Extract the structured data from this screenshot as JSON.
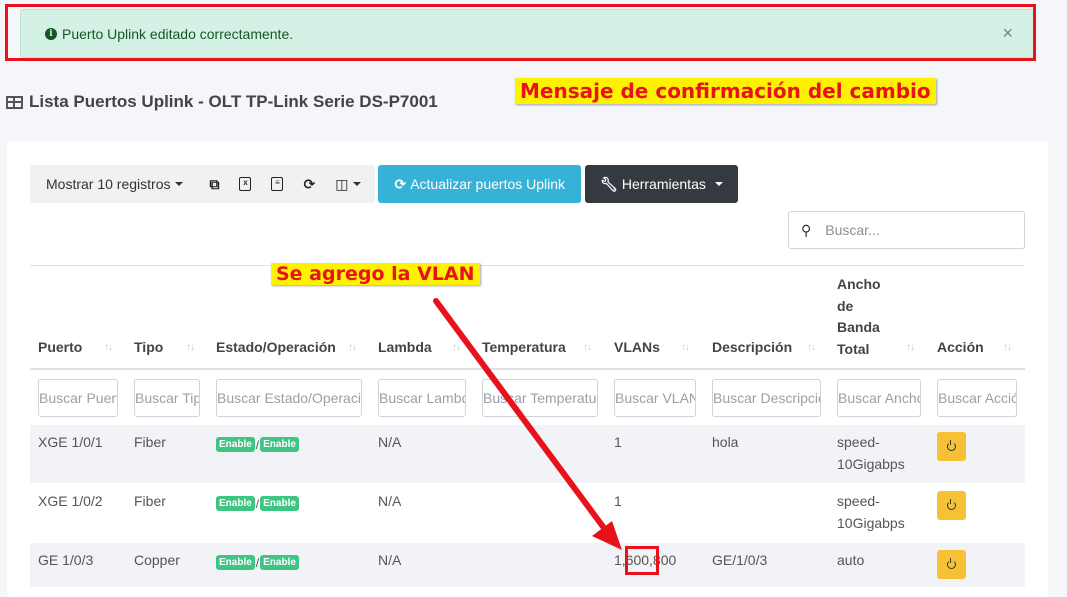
{
  "alert": {
    "text": "Puerto Uplink editado correctamente.",
    "close": "×",
    "icon": "info-circle-icon"
  },
  "title": "Lista Puertos Uplink - OLT TP-Link Serie DS-P7001",
  "annotations": {
    "confirm": "Mensaje de confirmación del cambio",
    "vlan": "Se agrego la VLAN"
  },
  "toolbar": {
    "show": "Mostrar 10 registros",
    "icons": [
      "copy-icon",
      "excel-icon",
      "csv-icon",
      "refresh-icon",
      "columns-icon"
    ],
    "update": "Actualizar puertos Uplink",
    "tools": "Herramientas"
  },
  "search": {
    "placeholder": "Buscar..."
  },
  "columns": [
    "Puerto",
    "Tipo",
    "Estado/Operación",
    "Lambda",
    "Temperatura",
    "VLANs",
    "Descripción",
    "Ancho de Banda Total",
    "Acción"
  ],
  "ancho_lines": [
    "Ancho",
    "de",
    "Banda",
    "Total"
  ],
  "filters": [
    "Buscar Puerto",
    "Buscar Tipo",
    "Buscar Estado/Operación",
    "Buscar Lambda",
    "Buscar Temperatura",
    "Buscar VLANs",
    "Buscar Descripción",
    "Buscar Ancho",
    "Buscar Acción"
  ],
  "rows": [
    {
      "puerto": "XGE 1/0/1",
      "tipo": "Fiber",
      "estado": "Enable",
      "operacion": "Enable",
      "lambda": "N/A",
      "temperatura": "",
      "vlans": "1",
      "descripcion": "hola",
      "ancho1": "speed-",
      "ancho2": "10Gigabps"
    },
    {
      "puerto": "XGE 1/0/2",
      "tipo": "Fiber",
      "estado": "Enable",
      "operacion": "Enable",
      "lambda": "N/A",
      "temperatura": "",
      "vlans": "1",
      "descripcion": "",
      "ancho1": "speed-",
      "ancho2": "10Gigabps"
    },
    {
      "puerto": "GE 1/0/3",
      "tipo": "Copper",
      "estado": "Enable",
      "operacion": "Enable",
      "lambda": "N/A",
      "temperatura": "",
      "vlans": "1,600,800",
      "descripcion": "GE/1/0/3",
      "ancho1": "auto",
      "ancho2": ""
    }
  ],
  "colors": {
    "alert_bg": "#d4f1e6",
    "info": "#36b2d8",
    "dark": "#343a40",
    "badge": "#3ec483",
    "power": "#f7c136",
    "annotation_red": "#e8121a",
    "annotation_yellow": "#fff200"
  }
}
